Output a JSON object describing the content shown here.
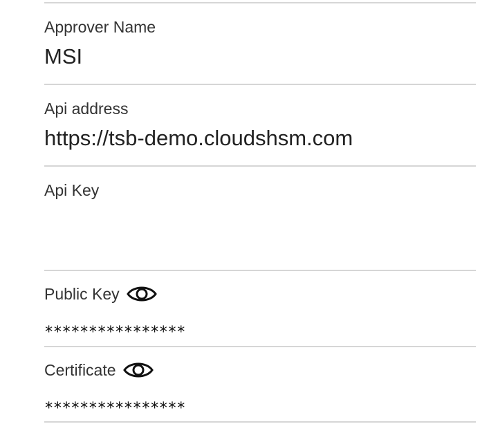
{
  "fields": {
    "approver_name": {
      "label": "Approver Name",
      "value": "MSI"
    },
    "api_address": {
      "label": "Api address",
      "value": "https://tsb-demo.cloudshsm.com"
    },
    "api_key": {
      "label": "Api Key",
      "value": ""
    },
    "public_key": {
      "label": "Public Key",
      "value": "****************",
      "icon": "eye-icon"
    },
    "certificate": {
      "label": "Certificate",
      "value": "****************",
      "icon": "eye-icon"
    }
  },
  "colors": {
    "divider": "#d6d6d6",
    "text": "#222222"
  }
}
